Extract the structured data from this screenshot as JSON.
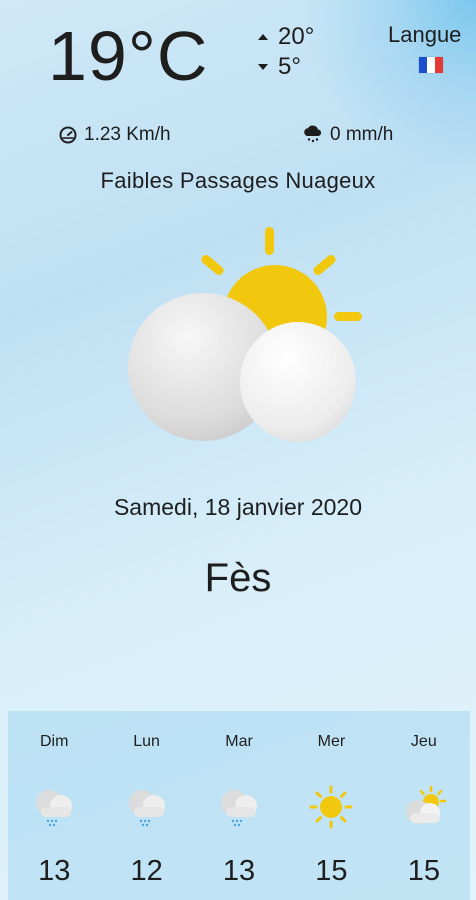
{
  "current": {
    "temperature": "19°C",
    "max": "20°",
    "min": "5°",
    "wind": "1.23 Km/h",
    "rain": "0 mm/h",
    "description": "Faibles Passages Nuageux",
    "date": "Samedi, 18 janvier 2020",
    "city": "Fès",
    "icon": "sun-behind-cloud-icon"
  },
  "language": {
    "label": "Langue",
    "flag_icon": "france-flag-icon",
    "flag_colors": [
      "#1f4fd1",
      "#ffffff",
      "#e53935"
    ]
  },
  "forecast": [
    {
      "day": "Dim",
      "temp": "13",
      "icon": "rain-cloud-icon"
    },
    {
      "day": "Lun",
      "temp": "12",
      "icon": "rain-cloud-icon"
    },
    {
      "day": "Mar",
      "temp": "13",
      "icon": "rain-cloud-icon"
    },
    {
      "day": "Mer",
      "temp": "15",
      "icon": "sun-icon"
    },
    {
      "day": "Jeu",
      "temp": "15",
      "icon": "sun-behind-cloud-icon"
    }
  ],
  "colors": {
    "sun": "#f2c80f",
    "text": "#1e1e1e",
    "rain_drops": "#4aa3e0"
  }
}
